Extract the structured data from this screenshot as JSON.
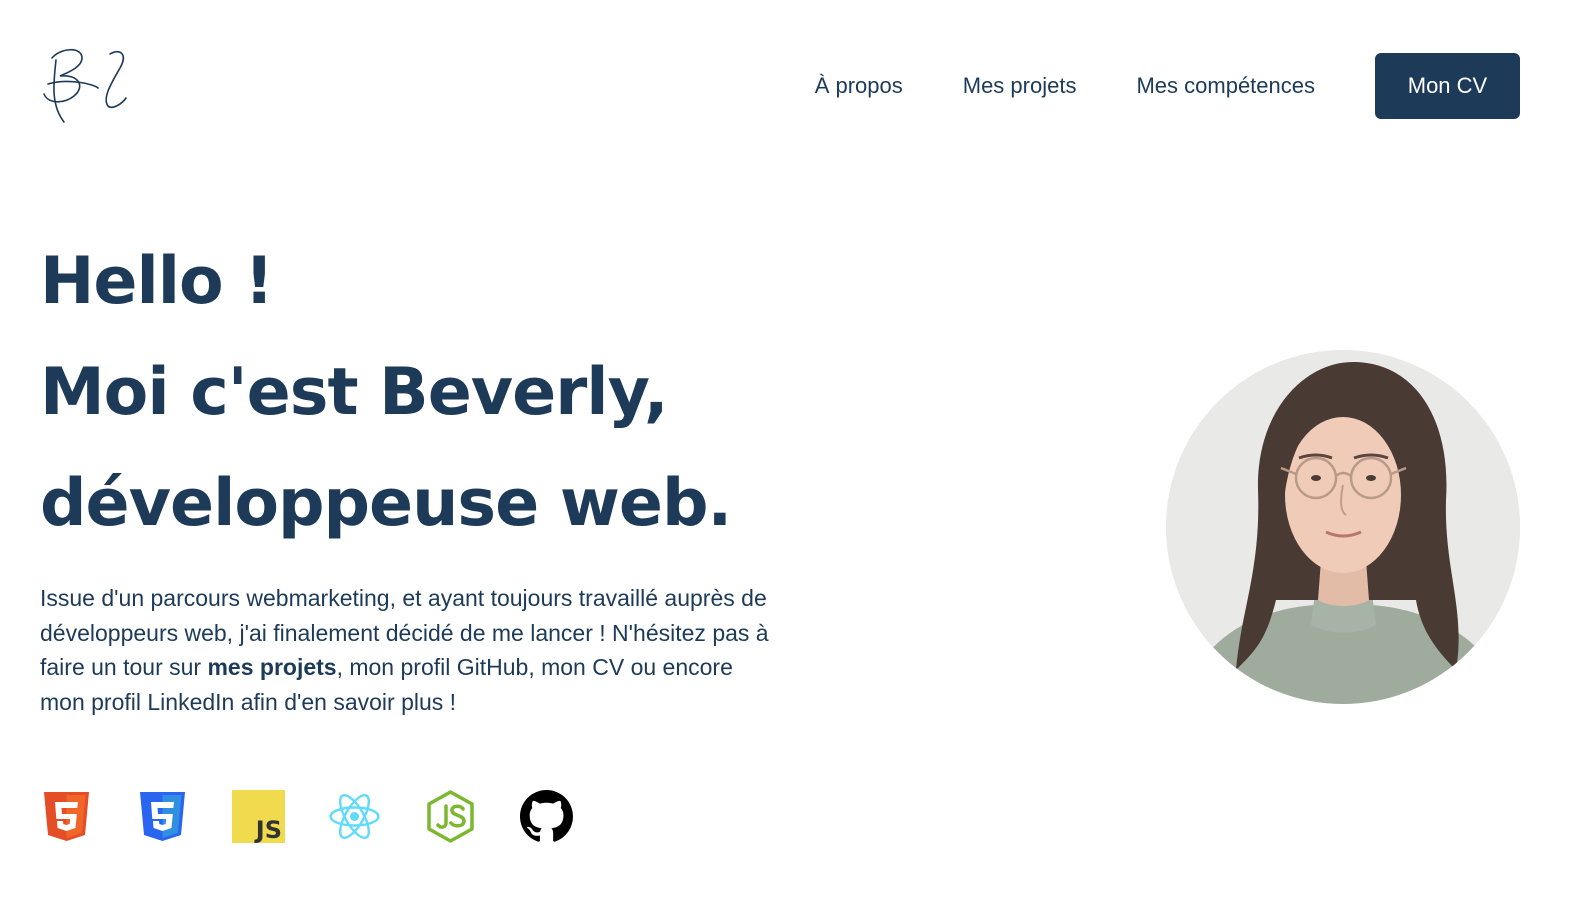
{
  "nav": {
    "about": "À propos",
    "projects": "Mes projets",
    "skills": "Mes compétences",
    "cv_button": "Mon CV"
  },
  "hero": {
    "line1": "Hello !",
    "line2": "Moi c'est Beverly,",
    "line3": "développeuse web."
  },
  "intro": {
    "part1": "Issue d'un parcours webmarketing, et ayant toujours travaillé auprès de développeurs web, j'ai finalement décidé de me lancer ! N'hésitez pas à faire un tour sur ",
    "projects_link": "mes projets",
    "part2": ", mon profil GitHub, mon CV ou encore mon profil LinkedIn afin d'en savoir plus !"
  },
  "tech_icons": [
    "html5-icon",
    "css3-icon",
    "javascript-icon",
    "react-icon",
    "nodejs-icon",
    "github-icon"
  ],
  "js_badge_text": "JS",
  "colors": {
    "primary": "#1d3a58",
    "html5": "#e44d26",
    "css3": "#2965f1",
    "js": "#f0db4f",
    "react": "#61dafb",
    "node": "#7cb82f"
  }
}
